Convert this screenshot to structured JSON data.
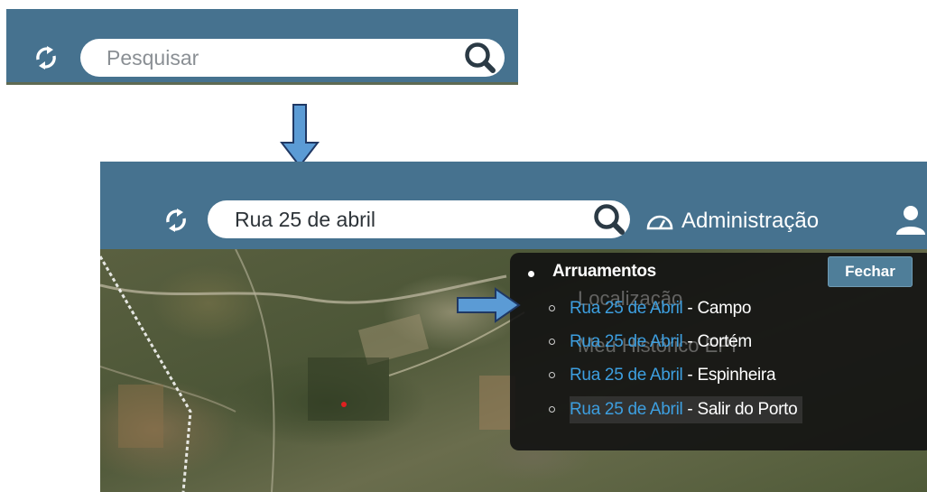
{
  "before": {
    "search": {
      "placeholder": "Pesquisar"
    },
    "icons": {
      "refresh": "refresh-icon",
      "search": "search-icon"
    }
  },
  "after": {
    "search": {
      "value": "Rua 25 de abril"
    },
    "header": {
      "admin_label": "Administração"
    },
    "icons": {
      "refresh": "refresh-icon",
      "search": "search-icon",
      "admin": "gauge-icon",
      "user": "user-icon"
    },
    "dropdown": {
      "group_label": "Arruamentos",
      "close_label": "Fechar",
      "background_ghost": {
        "line1": "Localização",
        "line2": "Meu Histórico EPI"
      },
      "results": [
        {
          "street": "Rua 25 de Abril",
          "separator": "-",
          "place": "Campo"
        },
        {
          "street": "Rua 25 de Abril",
          "separator": "-",
          "place": "Cortém"
        },
        {
          "street": "Rua 25 de Abril",
          "separator": "-",
          "place": "Espinheira"
        },
        {
          "street": "Rua 25 de Abril",
          "separator": "-",
          "place": "Salir do Porto"
        }
      ]
    }
  },
  "colors": {
    "header": "#46728f",
    "link": "#3d9fe0",
    "arrow_fill": "#5b9bd5",
    "arrow_stroke": "#1f3864"
  }
}
